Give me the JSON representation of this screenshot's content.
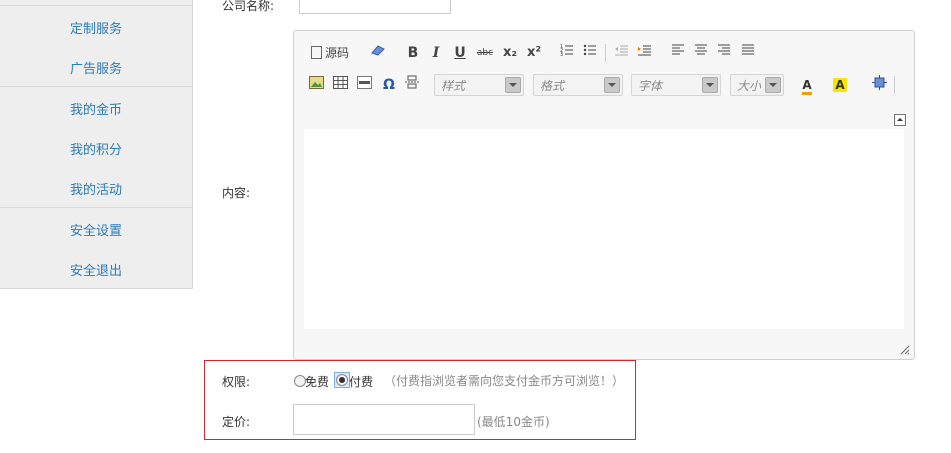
{
  "sidebar": {
    "items": [
      {
        "label": "定制服务"
      },
      {
        "label": "广告服务"
      },
      {
        "label": "我的金币"
      },
      {
        "label": "我的积分"
      },
      {
        "label": "我的活动"
      },
      {
        "label": "安全设置"
      },
      {
        "label": "安全退出"
      }
    ]
  },
  "form": {
    "company_label": "公司名称:",
    "content_label": "内容:",
    "permission_label": "权限:",
    "price_label": "定价:",
    "free_label": "免费",
    "paid_label": "付费",
    "permission_hint": "（付费指浏览者需向您支付金币方可浏览！）",
    "price_hint": "(最低10金币)",
    "selected_permission": "paid"
  },
  "editor": {
    "source_label": "源码",
    "style_placeholder": "样式",
    "format_placeholder": "格式",
    "font_placeholder": "字体",
    "size_placeholder": "大小",
    "bold": "B",
    "italic": "I",
    "underline": "U",
    "strike": "abc",
    "subscript": "x₂",
    "superscript": "x²",
    "text_color_glyph": "A",
    "bg_color_glyph": "A"
  },
  "colors": {
    "link": "#2b7cb9",
    "highlight_border": "#d9262c"
  }
}
